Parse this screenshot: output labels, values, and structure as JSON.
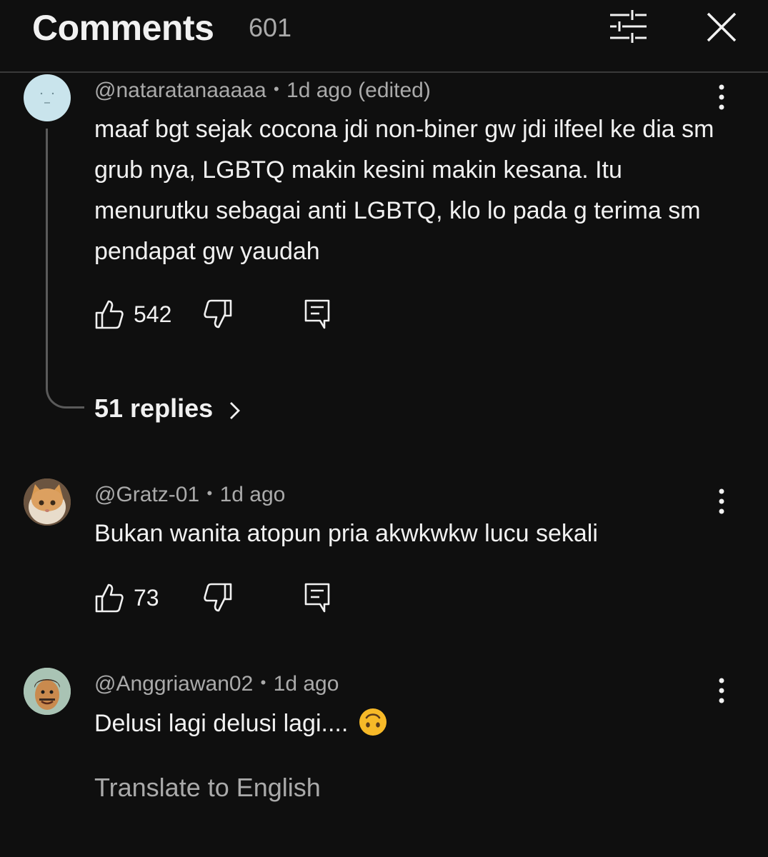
{
  "header": {
    "title": "Comments",
    "count": "601",
    "filter_icon": "sliders-icon",
    "close_icon": "close-icon"
  },
  "comments": [
    {
      "author": "@nataratanaaaaa",
      "separator": "•",
      "time": "1d ago (edited)",
      "text": "maaf bgt sejak cocona jdi non-biner gw jdi ilfeel ke dia sm grub nya, LGBTQ makin kesini makin kesana. Itu menurutku sebagai anti LGBTQ, klo lo pada g terima sm pendapat gw yaudah",
      "likes": "542",
      "replies_label": "51 replies"
    },
    {
      "author": "@Gratz-01",
      "separator": "•",
      "time": "1d ago",
      "text": "Bukan wanita atopun pria akwkwkw lucu sekali",
      "likes": "73"
    },
    {
      "author": "@Anggriawan02",
      "separator": "•",
      "time": "1d ago",
      "text": "Delusi lagi delusi lagi....",
      "emoji": "upside-down-face-emoji",
      "translate_label": "Translate to English"
    }
  ],
  "colors": {
    "background": "#0f0f0f",
    "primary_text": "#f1f1f1",
    "secondary_text": "#aaaaaa",
    "divider": "#3a3a3a"
  }
}
